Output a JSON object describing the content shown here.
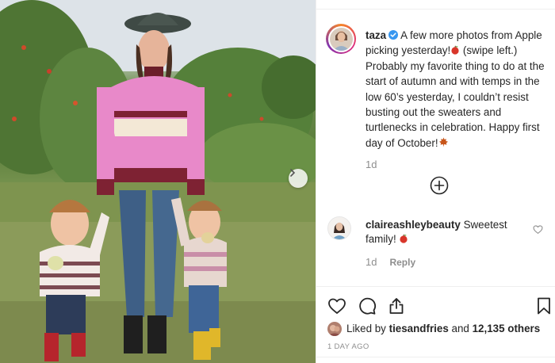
{
  "post": {
    "username": "taza",
    "caption": "A few more photos from Apple picking yesterday!",
    "caption_rest": " (swipe left.) Probably my favorite thing to do at the start of autumn and with temps in the low 60’s yesterday, I couldn’t resist busting out the sweaters and turtlenecks in celebration. Happy first day of October!",
    "age": "1d"
  },
  "comment": {
    "username": "claireashleybeauty",
    "text": "Sweetest family!",
    "age": "1d",
    "reply_label": "Reply"
  },
  "likes": {
    "prefix": "Liked by",
    "user": "tiesandfries",
    "connector": "and",
    "count_text": "12,135 others"
  },
  "timestamp": "1 DAY AGO",
  "colors": {
    "verified": "#3897f0",
    "apple_red": "#d8362a",
    "leaf": "#c8561b",
    "text": "#262626",
    "muted": "#8e8e8e"
  },
  "icons": [
    "verified-badge-icon",
    "apple-emoji-icon",
    "maple-leaf-emoji-icon",
    "chevron-right-icon",
    "plus-circle-icon",
    "heart-icon",
    "comment-icon",
    "share-icon",
    "bookmark-icon"
  ]
}
